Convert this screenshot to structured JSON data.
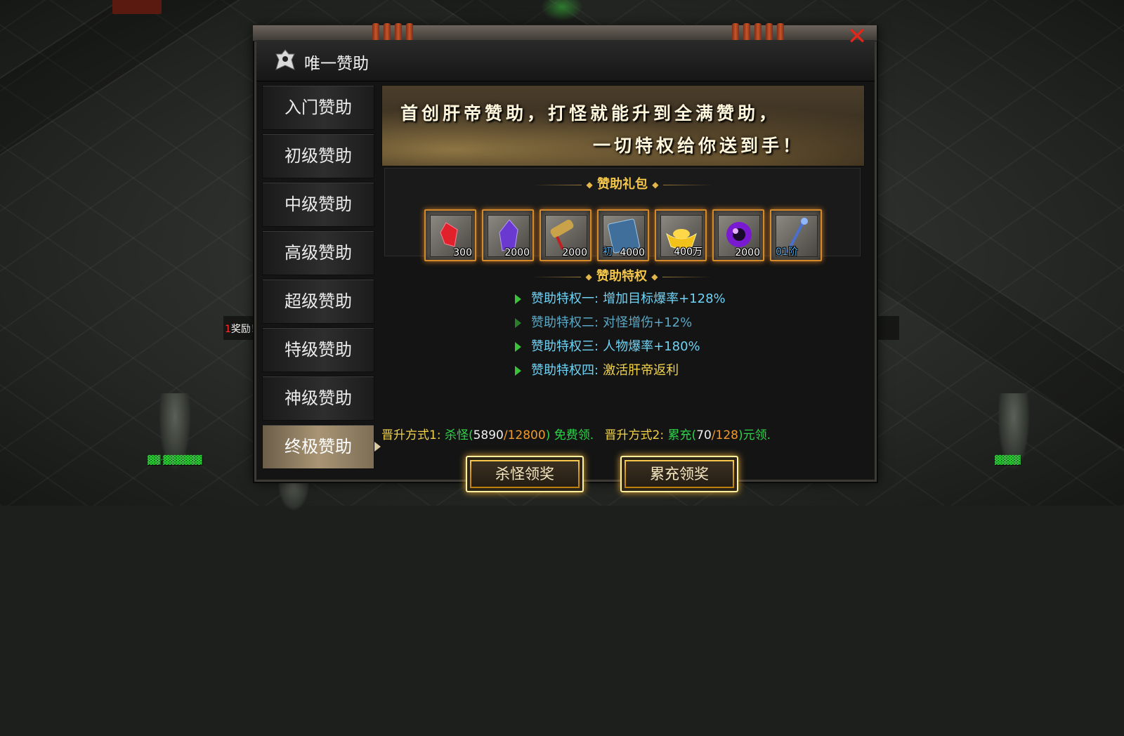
{
  "window": {
    "title": "唯一赞助"
  },
  "sidebar": {
    "items": [
      {
        "label": "入门赞助"
      },
      {
        "label": "初级赞助"
      },
      {
        "label": "中级赞助"
      },
      {
        "label": "高级赞助"
      },
      {
        "label": "超级赞助"
      },
      {
        "label": "特级赞助"
      },
      {
        "label": "神级赞助"
      },
      {
        "label": "终极赞助"
      }
    ],
    "active_index": 7
  },
  "banner": {
    "line1": "首创肝帝赞助，打怪就能升到全满赞助，",
    "line2": "一切特权给你送到手！"
  },
  "gift": {
    "title": "赞助礼包",
    "items": [
      {
        "icon": "red-gem-icon",
        "count": "300"
      },
      {
        "icon": "purple-crystal-icon",
        "count": "2000"
      },
      {
        "icon": "scroll-icon",
        "count": "2000"
      },
      {
        "icon": "skill-book-icon",
        "count": "4000",
        "prefix": "初"
      },
      {
        "icon": "gold-ingot-icon",
        "count": "400万"
      },
      {
        "icon": "purple-orb-icon",
        "count": "2000"
      },
      {
        "icon": "staff-weapon-icon",
        "count": "01阶"
      }
    ]
  },
  "privileges": {
    "title": "赞助特权",
    "items": [
      {
        "label": "赞助特权一:",
        "value": "增加目标爆率+128%"
      },
      {
        "label": "赞助特权二:",
        "value": "对怪增伤+12%"
      },
      {
        "label": "赞助特权三:",
        "value": "人物爆率+180%"
      },
      {
        "label": "赞助特权四:",
        "value": "激活肝帝返利"
      }
    ]
  },
  "promotion": {
    "method1_label": "晋升方式1:",
    "method1_text": "杀怪(",
    "kill_current": "5890",
    "sep": "/",
    "kill_target": "12800",
    "method1_suffix": ") 免费领.",
    "method2_label": "晋升方式2:",
    "method2_text": "累充(",
    "charge_current": "70",
    "charge_target": "128",
    "method2_suffix": ")元领."
  },
  "buttons": {
    "kill_reward": "杀怪领奖",
    "charge_reward": "累充领奖"
  },
  "chat": {
    "number": "1",
    "text": "奖励！！！"
  },
  "colors": {
    "accent_gold": "#f4c64a",
    "privilege_blue": "#6fd3f5",
    "green": "#2fd34a",
    "orange": "#f09a2a",
    "close_red": "#e2261a"
  }
}
